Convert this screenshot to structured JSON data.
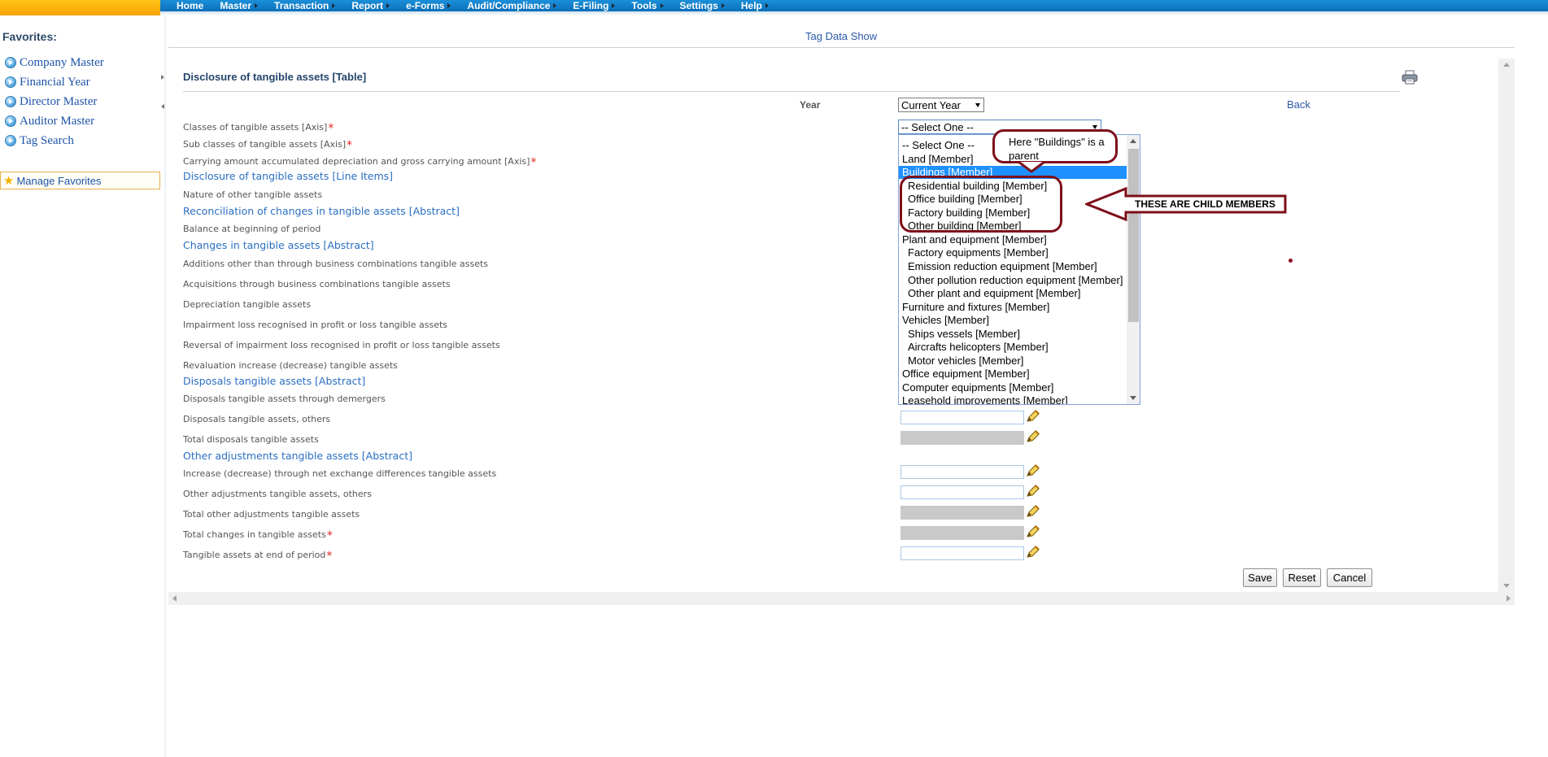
{
  "nav": {
    "items": [
      {
        "label": "Home",
        "arrow": false
      },
      {
        "label": "Master",
        "arrow": true
      },
      {
        "label": "Transaction",
        "arrow": true
      },
      {
        "label": "Report",
        "arrow": true
      },
      {
        "label": "e-Forms",
        "arrow": true
      },
      {
        "label": "Audit/Compliance",
        "arrow": true
      },
      {
        "label": "E-Filing",
        "arrow": true
      },
      {
        "label": "Tools",
        "arrow": true
      },
      {
        "label": "Settings",
        "arrow": true
      },
      {
        "label": "Help",
        "arrow": true
      }
    ]
  },
  "sidebar": {
    "title": "Favorites:",
    "links": [
      "Company Master",
      "Financial Year",
      "Director Master",
      "Auditor Master",
      "Tag Search"
    ],
    "manage_label": "Manage Favorites"
  },
  "page": {
    "title": "Tag Data Show",
    "section_title": "Disclosure of tangible assets [Table]",
    "year_label": "Year",
    "year_value": "Current Year",
    "back_label": "Back",
    "axis_select_value": "-- Select One --"
  },
  "rows": [
    {
      "label": "Classes of tangible assets [Axis]",
      "type": "label",
      "required": true
    },
    {
      "label": "Sub classes of tangible assets [Axis]",
      "type": "label",
      "required": true
    },
    {
      "label": "Carrying amount accumulated depreciation and gross carrying amount [Axis]",
      "type": "label",
      "required": true
    },
    {
      "label": "Disclosure of tangible assets [Line Items]",
      "type": "group"
    },
    {
      "label": "Nature of other tangible assets",
      "type": "label"
    },
    {
      "label": "Reconciliation of changes in tangible assets [Abstract]",
      "type": "group"
    },
    {
      "label": "Balance at beginning of period",
      "type": "label"
    },
    {
      "label": "Changes in tangible assets [Abstract]",
      "type": "group"
    },
    {
      "label": "Additions other than through business combinations tangible assets",
      "type": "label"
    },
    {
      "label": "Acquisitions through business combinations tangible assets",
      "type": "label"
    },
    {
      "label": "Depreciation tangible assets",
      "type": "label"
    },
    {
      "label": "Impairment loss recognised in profit or loss tangible assets",
      "type": "label"
    },
    {
      "label": "Reversal of impairment loss recognised in profit or loss tangible assets",
      "type": "label"
    },
    {
      "label": "Revaluation increase (decrease) tangible assets",
      "type": "label"
    },
    {
      "label": "Disposals tangible assets [Abstract]",
      "type": "group"
    },
    {
      "label": "Disposals tangible assets through demergers",
      "type": "label"
    },
    {
      "label": "Disposals tangible assets, others",
      "type": "label",
      "input": "enabled"
    },
    {
      "label": "Total disposals tangible assets",
      "type": "label",
      "input": "disabled"
    },
    {
      "label": "Other adjustments tangible assets [Abstract]",
      "type": "group"
    },
    {
      "label": "Increase (decrease) through net exchange differences tangible assets",
      "type": "label",
      "input": "enabled"
    },
    {
      "label": "Other adjustments tangible assets, others",
      "type": "label",
      "input": "enabled"
    },
    {
      "label": "Total other adjustments tangible assets",
      "type": "label",
      "input": "disabled"
    },
    {
      "label": "Total changes in tangible assets",
      "type": "label",
      "required": true,
      "input": "disabled"
    },
    {
      "label": "Tangible assets at end of period",
      "type": "label",
      "required": true,
      "input": "enabled"
    }
  ],
  "dropdown": {
    "options": [
      {
        "label": "-- Select One --",
        "child": false,
        "selected": false
      },
      {
        "label": "Land [Member]",
        "child": false,
        "selected": false
      },
      {
        "label": "Buildings [Member]",
        "child": false,
        "selected": true
      },
      {
        "label": "Residential building [Member]",
        "child": true,
        "selected": false
      },
      {
        "label": "Office building [Member]",
        "child": true,
        "selected": false
      },
      {
        "label": "Factory building [Member]",
        "child": true,
        "selected": false
      },
      {
        "label": "Other building [Member]",
        "child": true,
        "selected": false
      },
      {
        "label": "Plant and equipment [Member]",
        "child": false,
        "selected": false
      },
      {
        "label": "Factory equipments [Member]",
        "child": true,
        "selected": false
      },
      {
        "label": "Emission reduction equipment [Member]",
        "child": true,
        "selected": false
      },
      {
        "label": "Other pollution reduction equipment [Member]",
        "child": true,
        "selected": false
      },
      {
        "label": "Other plant and equipment [Member]",
        "child": true,
        "selected": false
      },
      {
        "label": "Furniture and fixtures [Member]",
        "child": false,
        "selected": false
      },
      {
        "label": "Vehicles [Member]",
        "child": false,
        "selected": false
      },
      {
        "label": "Ships vessels [Member]",
        "child": true,
        "selected": false
      },
      {
        "label": "Aircrafts helicopters [Member]",
        "child": true,
        "selected": false
      },
      {
        "label": "Motor vehicles [Member]",
        "child": true,
        "selected": false
      },
      {
        "label": "Office equipment [Member]",
        "child": false,
        "selected": false
      },
      {
        "label": "Computer equipments [Member]",
        "child": false,
        "selected": false
      },
      {
        "label": "Leasehold improvements [Member]",
        "child": false,
        "selected": false
      }
    ]
  },
  "buttons": {
    "save": "Save",
    "reset": "Reset",
    "cancel": "Cancel"
  },
  "annotations": {
    "parent_note": "Here \"Buildings\" is a parent",
    "child_note": "THESE ARE CHILD MEMBERS"
  },
  "colors": {
    "accent": "#1b8fd9",
    "annotation": "#7d0f1a",
    "selected": "#1e90ff",
    "required": "#e2261f"
  }
}
